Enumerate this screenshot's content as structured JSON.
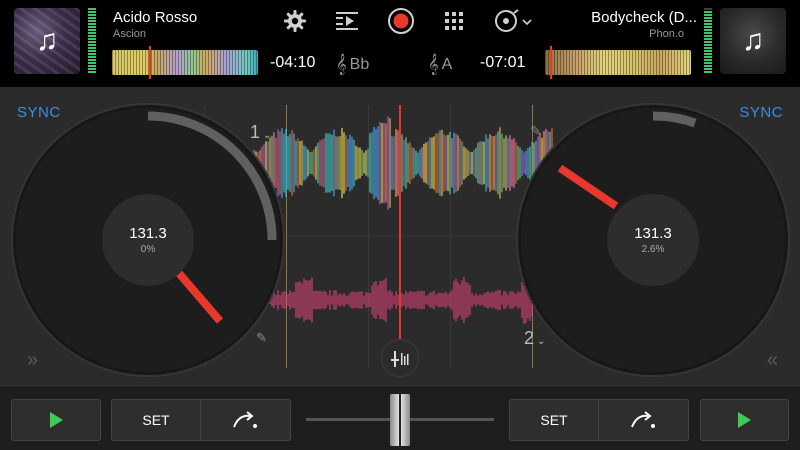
{
  "deck_a": {
    "title": "Acido Rosso",
    "artist": "Ascion",
    "time_remaining": "-04:10",
    "key": "Bb",
    "bpm": "131.3",
    "pitch": "0%",
    "number": "1",
    "sync_label": "SYNC",
    "set_label": "SET",
    "icon_art": "music-note-icon"
  },
  "deck_b": {
    "title": "Bodycheck (D...",
    "artist": "Phon.o",
    "time_remaining": "-07:01",
    "key": "A",
    "bpm": "131.3",
    "pitch": "2.6%",
    "number": "2",
    "sync_label": "SYNC",
    "set_label": "SET",
    "icon_art": "music-note-icon"
  },
  "colors": {
    "sync": "#3a8ee6",
    "playhead": "#e8372b",
    "play": "#3ecb5a",
    "record": "#e8372b",
    "deck_a_waveform": "multicolor",
    "deck_b_waveform": "#e0457a"
  },
  "toolbar": {
    "icons": [
      "settings-icon",
      "fx-icon",
      "record-icon",
      "sampler-grid-icon",
      "vinyl-mode-icon"
    ]
  },
  "crossfader": {
    "position": 0.5
  }
}
